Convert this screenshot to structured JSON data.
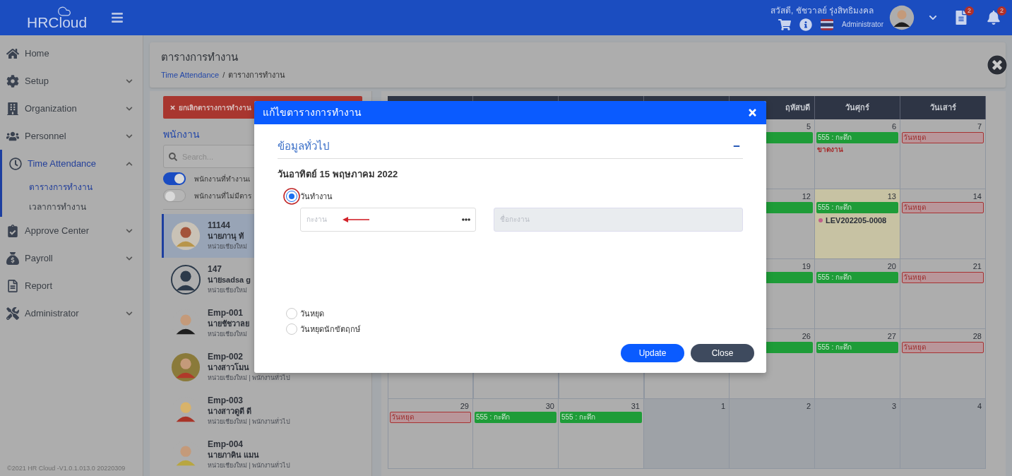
{
  "header": {
    "logo": "HRCloud",
    "greeting": "สวัสดี, ชัชวาลย์ รุ่งสิทธิมงคล",
    "role": "Administrator",
    "document_badge": "2",
    "notification_badge": "2"
  },
  "sidebar": {
    "items": [
      {
        "label": "Home",
        "kind": "link",
        "selected": false
      },
      {
        "label": "Setup",
        "kind": "group",
        "expanded": false,
        "selected": false
      },
      {
        "label": "Organization",
        "kind": "group",
        "expanded": false,
        "selected": false
      },
      {
        "label": "Personnel",
        "kind": "group",
        "expanded": false,
        "selected": false
      },
      {
        "label": "Time Attendance",
        "kind": "group",
        "expanded": true,
        "selected": true,
        "children": [
          {
            "label": "ตารางการทำงาน",
            "selected": true
          },
          {
            "label": "เวลาการทำงาน",
            "selected": false
          }
        ]
      },
      {
        "label": "Approve Center",
        "kind": "group",
        "expanded": false,
        "selected": false
      },
      {
        "label": "Payroll",
        "kind": "group",
        "expanded": false,
        "selected": false
      },
      {
        "label": "Report",
        "kind": "link",
        "selected": false
      },
      {
        "label": "Administrator",
        "kind": "group",
        "expanded": false,
        "selected": false
      }
    ],
    "footer": "©2021 HR Cloud -V1.0.1.013.0 20220309"
  },
  "page": {
    "title": "ตารางการทำงาน",
    "breadcrumb": [
      {
        "label": "Time Attendance",
        "kind": "link"
      },
      {
        "label": "ตารางการทำงาน",
        "kind": "current"
      }
    ],
    "breadcrumb_separator": "/"
  },
  "employee_panel": {
    "cancel_button": "ยกเลิกตารางการทำงาน",
    "heading": "พนักงาน",
    "search": {
      "placeholder": "Search..."
    },
    "toggles": [
      {
        "label": "พนักงานที่ทำงานเ",
        "on": true
      },
      {
        "label": "พนักงานที่ไม่มีตาร",
        "on": false
      }
    ],
    "employees": [
      {
        "code": "11144",
        "name": "นายภานุ ทั",
        "unit": "หน่วยเชียงใหม่",
        "selected": true
      },
      {
        "code": "147",
        "name": "นายsadsa g",
        "unit": "หน่วยเชียงใหม่",
        "selected": false
      },
      {
        "code": "Emp-001",
        "name": "นายชัชวาลย",
        "unit": "หน่วยเชียงใหม่",
        "selected": false
      },
      {
        "code": "Emp-002",
        "name": "นางสาวโมน",
        "unit": "หน่วยเชียงใหม่ | พนักงานทั่วไป",
        "selected": false
      },
      {
        "code": "Emp-003",
        "name": "นางสาวดูดี ดี",
        "unit": "หน่วยเชียงใหม่ | พนักงานทั่วไป",
        "selected": false
      },
      {
        "code": "Emp-004",
        "name": "นายภาคิน แมน",
        "unit": "หน่วยเชียงใหม่ | พนักงานทั่วไป",
        "selected": false
      }
    ]
  },
  "calendar": {
    "weekdays": [
      "ฤหัสบดี",
      "วันศุกร์",
      "วันเสาร์"
    ],
    "weeks": [
      {
        "days": [
          {
            "day": "5",
            "today": false,
            "outside_month": false,
            "events": [
              {
                "kind": "shift"
              }
            ]
          },
          {
            "day": "6",
            "today": false,
            "outside_month": false,
            "events": [
              {
                "kind": "shift",
                "label": "555 : กะดึก"
              },
              {
                "kind": "absent",
                "label": "ขาดงาน"
              }
            ]
          },
          {
            "day": "7",
            "today": false,
            "outside_month": false,
            "events": [
              {
                "kind": "holiday",
                "label": "วันหยุด"
              }
            ]
          }
        ]
      },
      {
        "days": [
          {
            "day": "12",
            "today": false,
            "outside_month": false,
            "events": [
              {
                "kind": "shift"
              }
            ]
          },
          {
            "day": "13",
            "today": true,
            "outside_month": false,
            "events": [
              {
                "kind": "shift",
                "label": "555 : กะดึก"
              },
              {
                "kind": "leave",
                "label": "LEV202205-0008"
              }
            ]
          },
          {
            "day": "14",
            "today": false,
            "outside_month": false,
            "events": [
              {
                "kind": "holiday",
                "label": "วันหยุด"
              }
            ]
          }
        ]
      },
      {
        "days": [
          {
            "day": "19",
            "today": false,
            "outside_month": false,
            "events": [
              {
                "kind": "shift"
              }
            ]
          },
          {
            "day": "20",
            "today": false,
            "outside_month": false,
            "events": [
              {
                "kind": "shift",
                "label": "555 : กะดึก"
              }
            ]
          },
          {
            "day": "21",
            "today": false,
            "outside_month": false,
            "events": [
              {
                "kind": "holiday",
                "label": "วันหยุด"
              }
            ]
          }
        ]
      },
      {
        "days": [
          {
            "day": "26",
            "today": false,
            "outside_month": false,
            "events": [
              {
                "kind": "shift"
              }
            ]
          },
          {
            "day": "27",
            "today": false,
            "outside_month": false,
            "events": [
              {
                "kind": "shift",
                "label": "555 : กะดึก"
              }
            ]
          },
          {
            "day": "28",
            "today": false,
            "outside_month": false,
            "events": [
              {
                "kind": "holiday",
                "label": "วันหยุด"
              }
            ]
          }
        ]
      },
      {
        "days": [
          {
            "day": "29",
            "today": false,
            "outside_month": false,
            "events": [
              {
                "kind": "holiday",
                "label": "วันหยุด"
              }
            ]
          },
          {
            "day": "30",
            "today": false,
            "outside_month": false,
            "events": [
              {
                "kind": "shift",
                "label": "555 : กะดึก"
              }
            ]
          },
          {
            "day": "31",
            "today": false,
            "outside_month": false,
            "events": [
              {
                "kind": "shift",
                "label": "555 : กะดึก"
              }
            ]
          },
          {
            "day": "1",
            "today": false,
            "outside_month": true
          },
          {
            "day": "2",
            "today": false,
            "outside_month": true
          },
          {
            "day": "3",
            "today": false,
            "outside_month": true
          },
          {
            "day": "4",
            "today": false,
            "outside_month": true
          }
        ]
      }
    ]
  },
  "dialog": {
    "title": "แก้ไขตารางการทำงาน",
    "section": "ข้อมูลทั่วไป",
    "date": "วันอาทิตย์ 15 พฤษภาคม 2022",
    "options": [
      {
        "label": "วันทำงาน",
        "selected": true
      },
      {
        "label": "วันหยุด",
        "selected": false
      },
      {
        "label": "วันหยุดนักขัตฤกษ์",
        "selected": false
      }
    ],
    "shift_field": {
      "placeholder": "กะงาน"
    },
    "shift_name_field": {
      "placeholder": "ชื่อกะงาน",
      "disabled": true
    },
    "buttons": [
      {
        "label": "Update",
        "kind": "primary"
      },
      {
        "label": "Close",
        "kind": "secondary"
      }
    ]
  }
}
